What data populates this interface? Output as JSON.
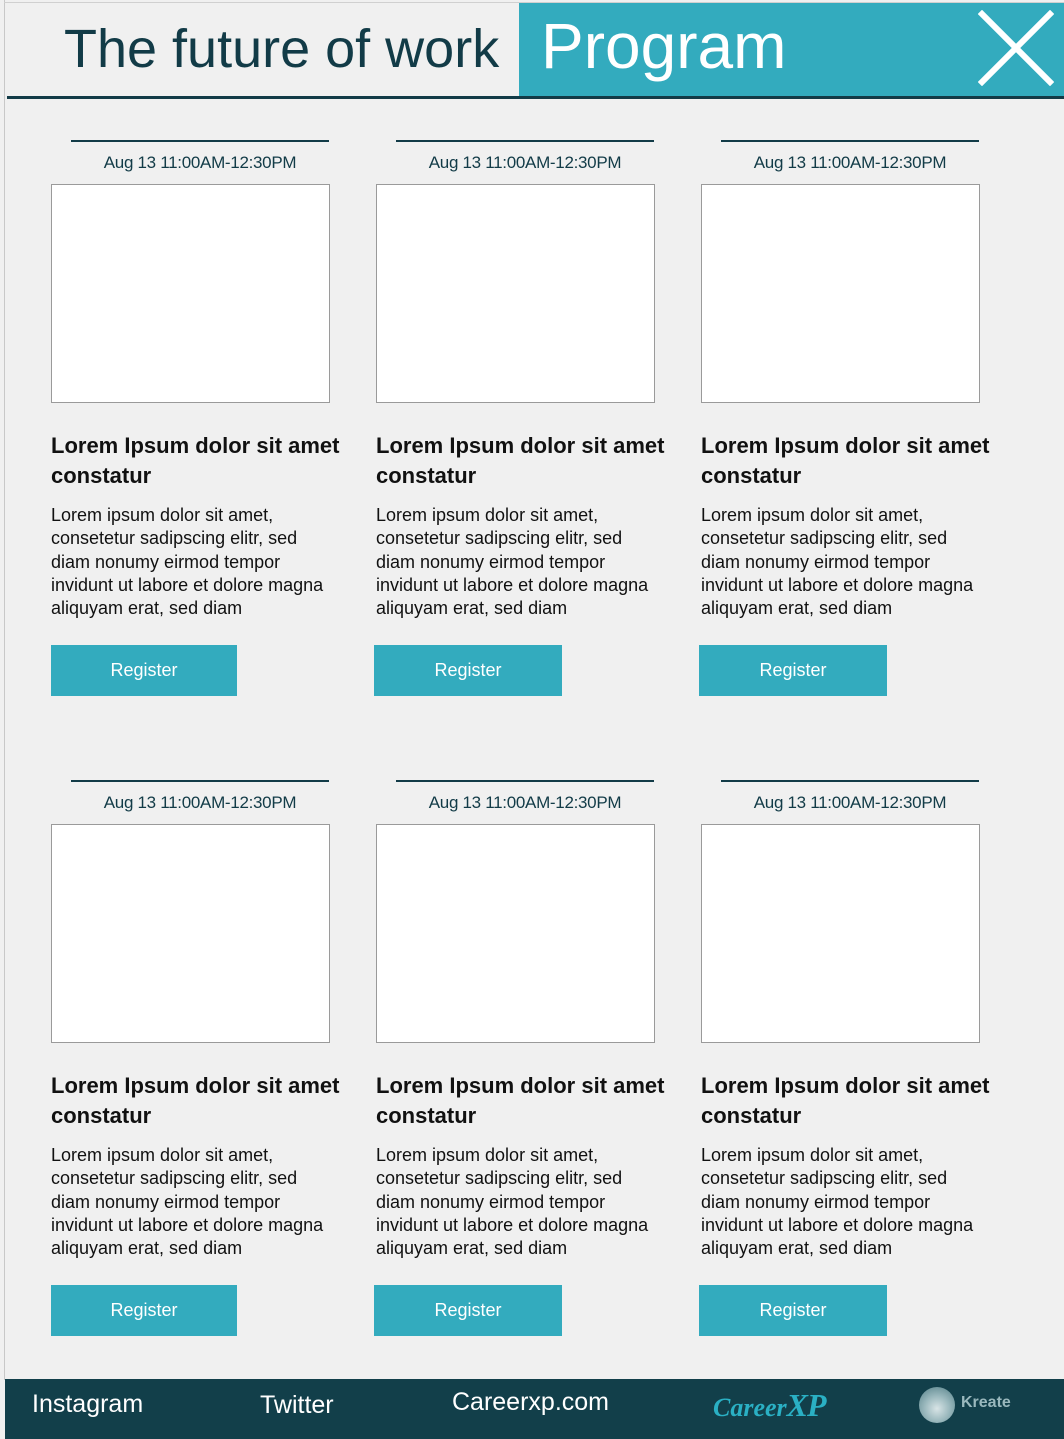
{
  "header": {
    "title": "The future of work",
    "program_label": "Program",
    "close_icon": "close-icon"
  },
  "cards": [
    {
      "date": "Aug 13 11:00AM-12:30PM",
      "title": "Lorem Ipsum dolor sit amet constatur",
      "description": "Lorem ipsum dolor sit amet, consetetur sadipscing elitr, sed diam nonumy eirmod tempor invidunt ut labore et dolore magna aliquyam erat, sed diam",
      "button_label": "Register"
    },
    {
      "date": "Aug 13 11:00AM-12:30PM",
      "title": "Lorem Ipsum dolor sit amet constatur",
      "description": "Lorem ipsum dolor sit amet, consetetur sadipscing elitr, sed diam nonumy eirmod tempor invidunt ut labore et dolore magna aliquyam erat, sed diam",
      "button_label": "Register"
    },
    {
      "date": "Aug 13 11:00AM-12:30PM",
      "title": "Lorem Ipsum dolor sit amet constatur",
      "description": "Lorem ipsum dolor sit amet, consetetur sadipscing elitr, sed diam nonumy eirmod tempor invidunt ut labore et dolore magna aliquyam erat, sed diam",
      "button_label": "Register"
    },
    {
      "date": "Aug 13 11:00AM-12:30PM",
      "title": "Lorem Ipsum dolor sit amet constatur",
      "description": "Lorem ipsum dolor sit amet, consetetur sadipscing elitr, sed diam nonumy eirmod tempor invidunt ut labore et dolore magna aliquyam erat, sed diam",
      "button_label": "Register"
    },
    {
      "date": "Aug 13 11:00AM-12:30PM",
      "title": "Lorem Ipsum dolor sit amet constatur",
      "description": "Lorem ipsum dolor sit amet, consetetur sadipscing elitr, sed diam nonumy eirmod tempor invidunt ut labore et dolore magna aliquyam erat, sed diam",
      "button_label": "Register"
    },
    {
      "date": "Aug 13 11:00AM-12:30PM",
      "title": "Lorem Ipsum dolor sit amet constatur",
      "description": "Lorem ipsum dolor sit amet, consetetur sadipscing elitr, sed diam nonumy eirmod tempor invidunt ut labore et dolore magna aliquyam erat, sed diam",
      "button_label": "Register"
    }
  ],
  "footer": {
    "links": [
      "Instagram",
      "Twitter",
      "Careerxp.com"
    ],
    "logo_careerxp": {
      "part1": "Career",
      "part2": "XP"
    },
    "logo_kreate": "Kreate"
  },
  "colors": {
    "accent": "#33abbe",
    "dark": "#123b47",
    "footer_bg": "#123f4a",
    "background": "#f0f0f0"
  }
}
